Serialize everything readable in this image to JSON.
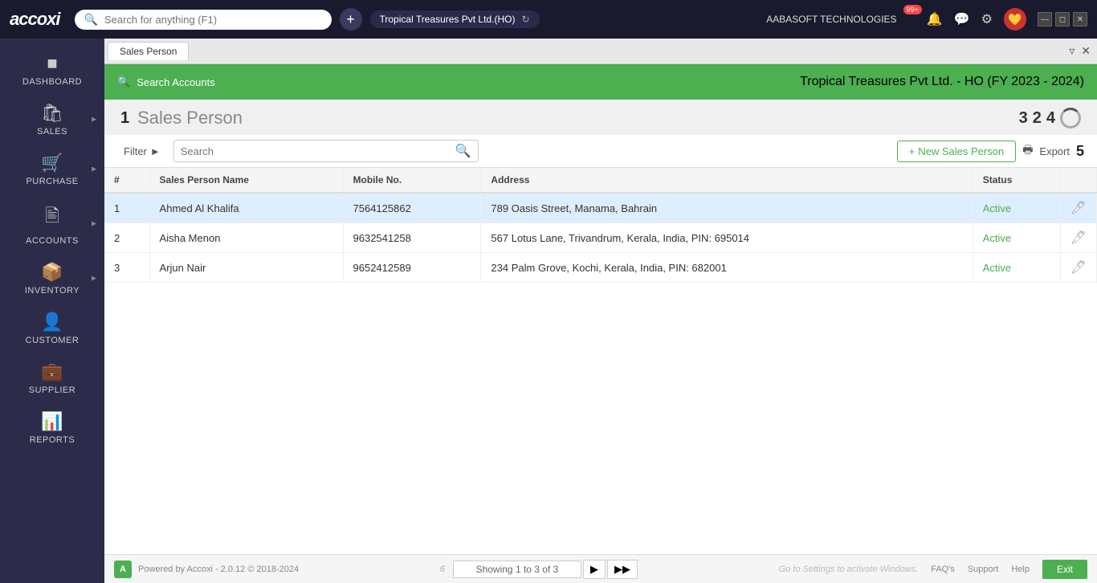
{
  "topbar": {
    "logo": "accoxi",
    "search_placeholder": "Search for anything (F1)",
    "company": "Tropical Treasures Pvt Ltd.(HO)",
    "company_label": "AABASOFT TECHNOLOGIES",
    "notification_count": "99+"
  },
  "tab": {
    "label": "Sales Person",
    "close": "×",
    "pin": "📌",
    "collapse": "▼"
  },
  "green_header": {
    "search_accounts": "Search Accounts",
    "company_info": "Tropical Treasures Pvt Ltd. - HO (FY 2023 - 2024)"
  },
  "page": {
    "title": "Sales Person",
    "num1": "1",
    "num2": "2",
    "num3": "3",
    "num4": "4",
    "num5": "5",
    "num6": "6"
  },
  "toolbar": {
    "filter_label": "Filter",
    "search_placeholder": "Search",
    "new_button": "New Sales Person",
    "export_button": "Export"
  },
  "table": {
    "columns": [
      "#",
      "Sales Person Name",
      "Mobile No.",
      "Address",
      "Status"
    ],
    "rows": [
      {
        "num": "1",
        "name": "Ahmed Al Khalifa",
        "mobile": "7564125862",
        "address": "789 Oasis Street, Manama, Bahrain",
        "status": "Active",
        "selected": true
      },
      {
        "num": "2",
        "name": "Aisha Menon",
        "mobile": "9632541258",
        "address": "567 Lotus Lane, Trivandrum, Kerala, India, PIN: 695014",
        "status": "Active",
        "selected": false
      },
      {
        "num": "3",
        "name": "Arjun Nair",
        "mobile": "9652412589",
        "address": "234 Palm Grove, Kochi, Kerala, India, PIN: 682001",
        "status": "Active",
        "selected": false
      }
    ]
  },
  "pagination": {
    "info": "Showing 1 to 3 of 3"
  },
  "footer": {
    "powered_by": "Powered by Accoxi - 2.0.12 © 2018-2024",
    "activate_windows": "Go to Settings to activate Windows.",
    "faqs": "FAQ's",
    "support": "Support",
    "help": "Help",
    "exit": "Exit"
  },
  "sidebar": {
    "items": [
      {
        "id": "dashboard",
        "label": "DASHBOARD",
        "icon": "⊞"
      },
      {
        "id": "sales",
        "label": "SALES",
        "icon": "🛍"
      },
      {
        "id": "purchase",
        "label": "PURCHASE",
        "icon": "🛒"
      },
      {
        "id": "accounts",
        "label": "ACCOUNTS",
        "icon": "🖩"
      },
      {
        "id": "inventory",
        "label": "INVENTORY",
        "icon": "📦"
      },
      {
        "id": "customer",
        "label": "CUSTOMER",
        "icon": "👤"
      },
      {
        "id": "supplier",
        "label": "SUPPLIER",
        "icon": "💼"
      },
      {
        "id": "reports",
        "label": "REPORTS",
        "icon": "📊"
      }
    ]
  }
}
